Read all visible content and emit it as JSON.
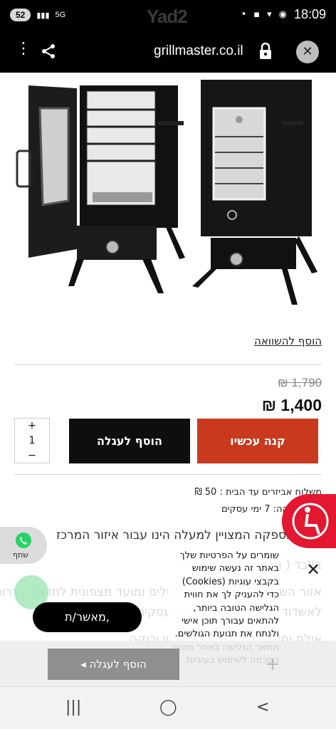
{
  "status_bar": {
    "battery": "52",
    "network": "5G",
    "carrier_logo": "Yad2",
    "time": "18:09"
  },
  "browser": {
    "url": "grillmaster.co.il",
    "menu_icon": "more-vert-icon",
    "share_icon": "share-icon",
    "lock_icon": "lock-icon",
    "close_icon": "close-icon"
  },
  "product": {
    "compare_link": "הוסף להשוואה",
    "old_price": "₪ 1,790",
    "price": "₪ 1,400",
    "quantity": "1",
    "qty_plus": "+",
    "qty_minus": "−",
    "add_to_cart": "הוסף לעגלה",
    "buy_now": "קנה עכשיו",
    "shipping_line": "משלוח אביזרים עד הבית : 50 ₪",
    "supply_line": "זמן אספקה: 7 ימי עסקים",
    "delivery_notice_1": "זמן האספקה המצויין למעלה הינו עבור איזור המרכז",
    "delivery_notice_2": "בלבד ( חדרה עד אשדוד )",
    "delivery_notice_3": "אזור השרון הצפוני / דרום ירושלים ומועד מצפונית לחדרה / דרום",
    "delivery_notice_4": "לאשדוד / אספקה עד 14 ימי עסקים",
    "delivery_notice_5": "אילת ומעבר להם / מעבר לקווי ירוקה"
  },
  "share": {
    "label": "שתף"
  },
  "cookie": {
    "text": "שומרים על הפרטיות שלך באתר זה נעשה שימוש בקבצי עוגיות (Cookies) כדי להעניק לך את חווית הגלישה הטובה ביותר, להתאים עבורך תוכן אישי ולנתח את תנועת הגולשים. המשך הגלישה באתר מהווה הסכמה לשימוש בעוגיות.",
    "accept": "מאשר/ת,",
    "close": "✕"
  },
  "sticky": {
    "add_to_cart": "הוסף לעגלה",
    "plus": "+"
  },
  "nav": {
    "recents": "|||",
    "home": "◯",
    "back": "<"
  },
  "colors": {
    "buy_button": "#c8391e",
    "cart_button": "#0e0e0e",
    "accessibility": "#e3172f"
  }
}
